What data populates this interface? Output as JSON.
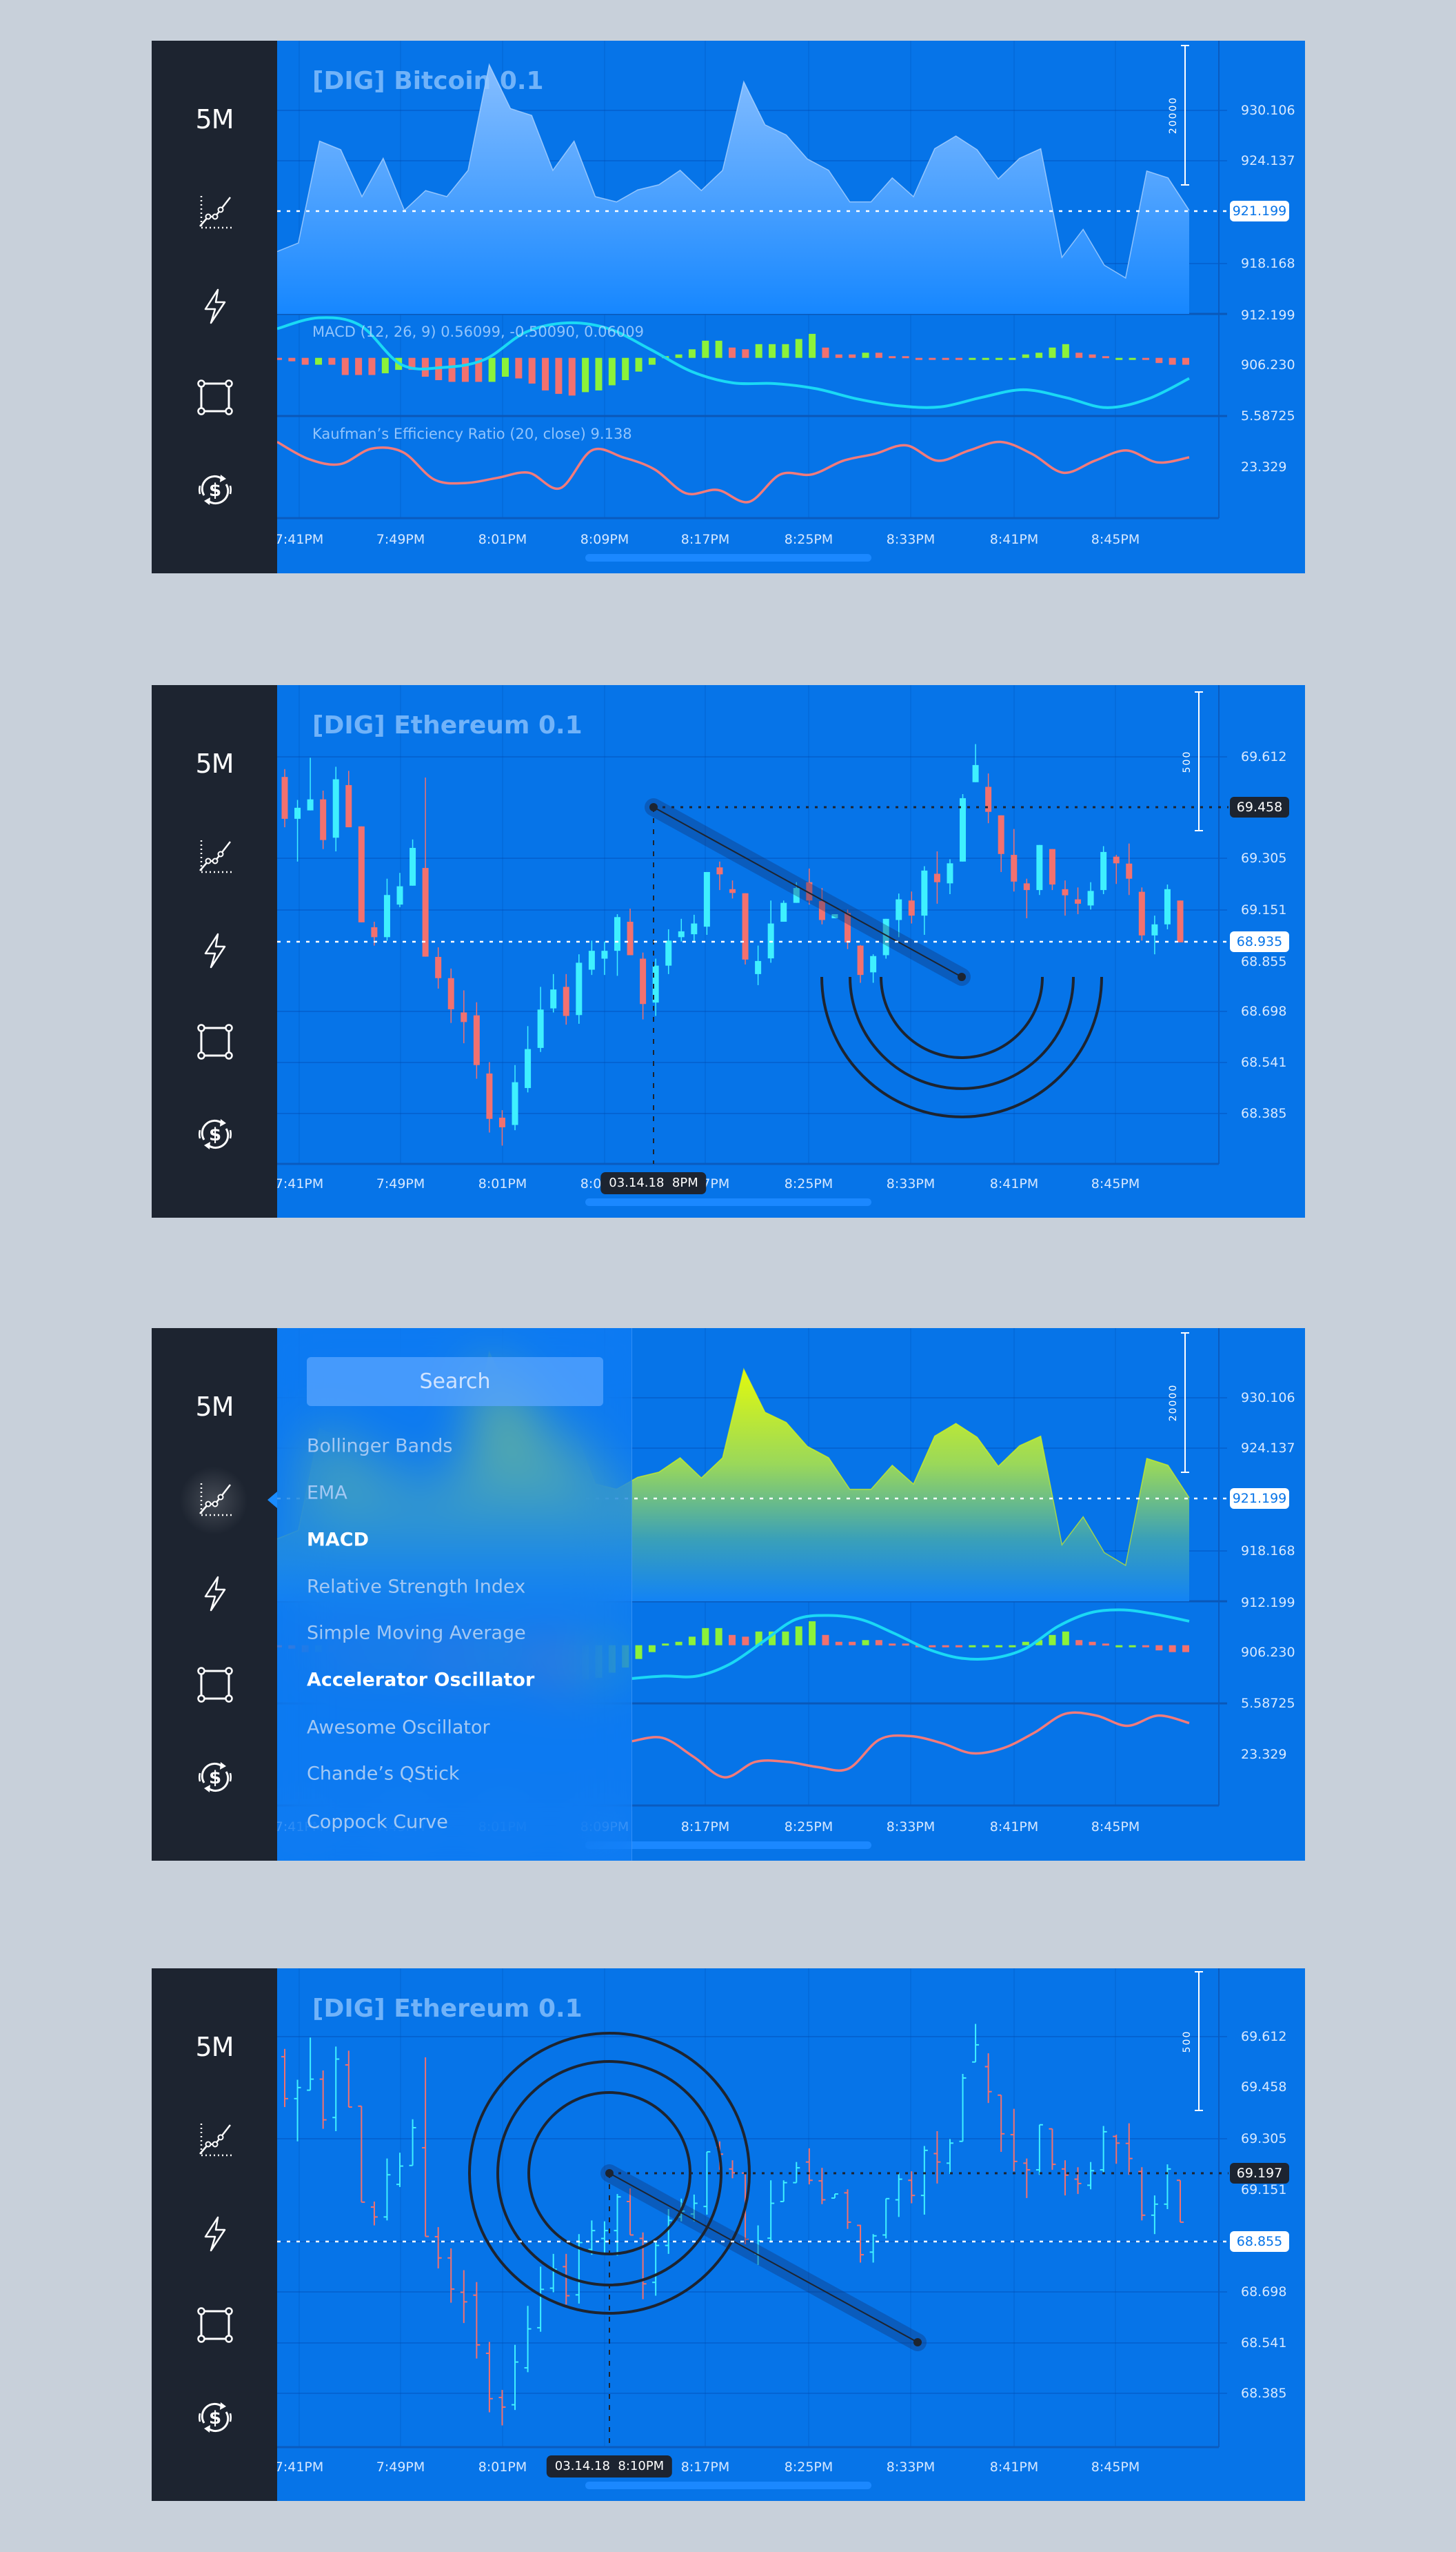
{
  "colors": {
    "page_background": "#c8d0da",
    "panel_blue": "#0674e8",
    "sidebar": "#1d2430",
    "candle_up": "#3ff0ff",
    "candle_down": "#f2716f",
    "histogram_up": "#8cf23a",
    "histogram_down": "#f2716f",
    "macd_line": "#1ad9f5",
    "ker_line": "#f27b7b",
    "area_top": "#86beff",
    "area_yellow": "#eeff00"
  },
  "sidebar": {
    "timeframe": "5M",
    "icons": [
      "indicators-chart-icon",
      "lightning-icon",
      "drawing-rectangle-icon",
      "currency-exchange-icon"
    ]
  },
  "time_axis": [
    "7:41PM",
    "7:49PM",
    "8:01PM",
    "8:09PM",
    "8:17PM",
    "8:25PM",
    "8:33PM",
    "8:41PM",
    "8:45PM"
  ],
  "panels": [
    {
      "title": "[DIG] Bitcoin 0.1",
      "price_labels": [
        "930.106",
        "924.137",
        "918.168",
        "912.199",
        "906.230",
        "5.58725",
        "23.329"
      ],
      "current_price": "921.199",
      "scale_label": "20000",
      "macd_label": "MACD (12, 26, 9) 0.56099, -0.50090, 0.06009",
      "ker_label": "Kaufman’s Efficiency Ratio (20, close) 9.138"
    },
    {
      "title": "[DIG] Ethereum 0.1",
      "price_labels": [
        "69.612",
        "69.305",
        "69.151",
        "68.855",
        "68.698",
        "68.541",
        "68.385"
      ],
      "current_price": "68.935",
      "crosshair_price": "69.458",
      "crosshair_time": "03.14.18  8PM",
      "scale_label": "500"
    },
    {
      "price_labels": [
        "930.106",
        "924.137",
        "918.168",
        "912.199",
        "906.230",
        "5.58725",
        "23.329"
      ],
      "current_price": "921.199",
      "scale_label": "20000",
      "menu": {
        "search_placeholder": "Search",
        "items": [
          {
            "label": "Bollinger Bands",
            "active": false
          },
          {
            "label": "EMA",
            "active": false
          },
          {
            "label": "MACD",
            "active": true
          },
          {
            "label": "Relative Strength Index",
            "active": false
          },
          {
            "label": "Simple Moving Average",
            "active": false
          },
          {
            "label": "Accelerator Oscillator",
            "active": true
          },
          {
            "label": "Awesome Oscillator",
            "active": false
          },
          {
            "label": "Chande’s QStick",
            "active": false
          },
          {
            "label": "Coppock Curve",
            "active": false
          }
        ]
      }
    },
    {
      "title": "[DIG] Ethereum 0.1",
      "price_labels": [
        "69.612",
        "69.458",
        "69.305",
        "69.151",
        "68.698",
        "68.541",
        "68.385"
      ],
      "current_price": "68.855",
      "crosshair_price": "69.197",
      "crosshair_time": "03.14.18  8:10PM",
      "scale_label": "500"
    }
  ],
  "chart_data": {
    "bitcoin_area": {
      "type": "area",
      "values": [
        917.77,
        918.52,
        927.42,
        926.67,
        922.57,
        925.92,
        921.37,
        923.1,
        922.57,
        924.87,
        934.1,
        930.27,
        929.67,
        924.87,
        927.42,
        922.57,
        922.11,
        923.16,
        923.61,
        924.87,
        923.1,
        924.87,
        932.61,
        928.85,
        927.96,
        925.86,
        924.87,
        922.11,
        922.11,
        924.21,
        922.57,
        926.76,
        927.87,
        926.67,
        924.12,
        925.92,
        926.76,
        917.26,
        919.71,
        916.57,
        915.46,
        924.81,
        924.21,
        921.37
      ]
    },
    "macd_histogram": {
      "type": "bar",
      "values": [
        -0.1,
        -0.2,
        -0.4,
        -0.4,
        -0.4,
        -1,
        -1,
        -1,
        -0.9,
        -0.7,
        -0.7,
        -1.1,
        -1.3,
        -1.4,
        -1.4,
        -1.4,
        -1.4,
        -1.1,
        -1.2,
        -1.5,
        -1.9,
        -2.1,
        -2.2,
        -2.0,
        -1.9,
        -1.6,
        -1.3,
        -0.8,
        -0.4,
        0.1,
        0.2,
        0.5,
        1.0,
        1.0,
        0.6,
        0.5,
        0.8,
        0.8,
        0.8,
        1.1,
        1.4,
        0.6,
        0.2,
        0.2,
        0.3,
        0.3,
        0.1,
        0.1,
        -0.05,
        -0.05,
        -0.1,
        -0.1,
        -0.05,
        -0.05,
        -0.05,
        -0.05,
        0.2,
        0.3,
        0.6,
        0.8,
        0.3,
        0.2,
        0.1,
        -0.05,
        -0.05,
        -0.1,
        -0.3,
        -0.4,
        -0.4
      ],
      "colors": [
        "r",
        "r",
        "r",
        "g",
        "r",
        "r",
        "r",
        "r",
        "g",
        "g",
        "r",
        "r",
        "r",
        "r",
        "r",
        "r",
        "g",
        "g",
        "r",
        "r",
        "r",
        "r",
        "r",
        "g",
        "g",
        "g",
        "g",
        "g",
        "g",
        "g",
        "g",
        "g",
        "g",
        "g",
        "r",
        "r",
        "g",
        "g",
        "g",
        "g",
        "g",
        "r",
        "r",
        "r",
        "g",
        "r",
        "r",
        "r",
        "r",
        "r",
        "r",
        "r",
        "g",
        "g",
        "g",
        "g",
        "g",
        "g",
        "g",
        "g",
        "r",
        "r",
        "r",
        "g",
        "g",
        "r",
        "r",
        "r",
        "r"
      ]
    },
    "macd_line_bitcoin": {
      "type": "line",
      "values": [
        1.7,
        2.34,
        1.9,
        -0.4,
        -0.56,
        -0.1,
        1.5,
        2.04,
        1.7,
        0.5,
        -0.8,
        -1.46,
        -1.5,
        -1.8,
        -2.4,
        -2.8,
        -2.86,
        -2.3,
        -1.86,
        -2.3,
        -2.9,
        -2.4,
        -1.2
      ]
    },
    "ker_line_bitcoin": {
      "type": "line",
      "values": [
        24.059,
        23.559,
        23.409,
        23.859,
        23.759,
        22.959,
        22.859,
        23.009,
        23.159,
        22.709,
        23.809,
        23.609,
        23.259,
        22.559,
        22.659,
        22.309,
        23.109,
        23.109,
        23.509,
        23.709,
        23.959,
        23.509,
        23.809,
        24.059,
        23.709,
        23.159,
        23.509,
        23.809,
        23.459,
        23.609
      ]
    },
    "macd_line_menu_view": {
      "type": "line",
      "values": [
        -1.94,
        -1.8,
        -1.8,
        -1.1,
        0.2,
        1.5,
        1.74,
        1.5,
        0.7,
        -0.2,
        -0.74,
        -0.76,
        -0.2,
        1.1,
        1.9,
        2.06,
        1.8,
        1.4
      ]
    },
    "ker_line_menu_view": {
      "type": "line",
      "values": [
        23.709,
        23.809,
        23.259,
        22.659,
        23.109,
        23.109,
        22.959,
        22.909,
        23.759,
        23.859,
        23.659,
        23.359,
        23.509,
        23.959,
        24.509,
        24.459,
        24.159,
        24.459,
        24.239
      ]
    },
    "ethereum_candles": {
      "type": "candlestick",
      "fields": [
        "open",
        "high",
        "low",
        "close"
      ],
      "values": [
        [
          69.543,
          69.57,
          69.37,
          69.399
        ],
        [
          69.399,
          69.464,
          69.252,
          69.437
        ],
        [
          69.428,
          69.609,
          69.428,
          69.466
        ],
        [
          69.466,
          69.496,
          69.295,
          69.326
        ],
        [
          69.334,
          69.578,
          69.287,
          69.535
        ],
        [
          69.515,
          69.564,
          69.37,
          69.37
        ],
        [
          69.373,
          69.373,
          69.043,
          69.043
        ],
        [
          69.026,
          69.045,
          68.963,
          68.992
        ],
        [
          68.992,
          69.193,
          68.98,
          69.137
        ],
        [
          69.104,
          69.213,
          69.095,
          69.167
        ],
        [
          69.169,
          69.328,
          69.169,
          69.299
        ],
        [
          69.23,
          69.541,
          68.925,
          68.925
        ],
        [
          68.924,
          68.957,
          68.815,
          68.851
        ],
        [
          68.851,
          68.884,
          68.697,
          68.744
        ],
        [
          68.733,
          68.809,
          68.627,
          68.7
        ],
        [
          68.723,
          68.768,
          68.505,
          68.552
        ],
        [
          68.523,
          68.562,
          68.32,
          68.367
        ],
        [
          68.371,
          68.397,
          68.275,
          68.338
        ],
        [
          68.346,
          68.552,
          68.328,
          68.493
        ],
        [
          68.473,
          68.686,
          68.458,
          68.607
        ],
        [
          68.611,
          68.821,
          68.597,
          68.743
        ],
        [
          68.747,
          68.865,
          68.733,
          68.812
        ],
        [
          68.821,
          68.865,
          68.691,
          68.721
        ],
        [
          68.724,
          68.933,
          68.694,
          68.904
        ],
        [
          68.88,
          68.98,
          68.862,
          68.945
        ],
        [
          68.918,
          68.977,
          68.862,
          68.945
        ],
        [
          68.945,
          69.071,
          68.859,
          69.061
        ],
        [
          69.045,
          69.09,
          68.93,
          68.93
        ],
        [
          68.918,
          68.939,
          68.709,
          68.762
        ],
        [
          68.767,
          68.918,
          68.721,
          68.894
        ],
        [
          68.894,
          69.019,
          68.865,
          68.98
        ],
        [
          68.992,
          69.055,
          68.977,
          69.012
        ],
        [
          69.002,
          69.069,
          68.977,
          69.039
        ],
        [
          69.028,
          69.216,
          69.0,
          69.216
        ],
        [
          69.232,
          69.252,
          69.154,
          69.208
        ],
        [
          69.157,
          69.187,
          69.125,
          69.144
        ],
        [
          69.143,
          69.143,
          68.898,
          68.915
        ],
        [
          68.865,
          68.963,
          68.827,
          68.91
        ],
        [
          68.919,
          69.118,
          68.904,
          69.039
        ],
        [
          69.045,
          69.118,
          69.045,
          69.11
        ],
        [
          69.11,
          69.181,
          69.11,
          69.161
        ],
        [
          69.181,
          69.228,
          69.104,
          69.118
        ],
        [
          69.116,
          69.161,
          69.036,
          69.051
        ],
        [
          69.057,
          69.071,
          69.057,
          69.071
        ],
        [
          69.075,
          69.087,
          68.951,
          68.974
        ],
        [
          68.963,
          68.965,
          68.835,
          68.862
        ],
        [
          68.871,
          68.933,
          68.835,
          68.927
        ],
        [
          68.93,
          69.055,
          68.918,
          69.055
        ],
        [
          69.051,
          69.142,
          68.992,
          69.122
        ],
        [
          69.118,
          69.149,
          69.039,
          69.066
        ],
        [
          69.066,
          69.236,
          69.0,
          69.221
        ],
        [
          69.21,
          69.287,
          69.107,
          69.181
        ],
        [
          69.177,
          69.26,
          69.14,
          69.246
        ],
        [
          69.252,
          69.484,
          69.252,
          69.47
        ],
        [
          69.525,
          69.656,
          69.525,
          69.584
        ],
        [
          69.509,
          69.555,
          69.384,
          69.423
        ],
        [
          69.411,
          69.411,
          69.216,
          69.278
        ],
        [
          69.275,
          69.364,
          69.149,
          69.183
        ],
        [
          69.177,
          69.193,
          69.057,
          69.154
        ],
        [
          69.154,
          69.309,
          69.137,
          69.309
        ],
        [
          69.295,
          69.295,
          69.154,
          69.173
        ],
        [
          69.157,
          69.187,
          69.066,
          69.136
        ],
        [
          69.122,
          69.163,
          69.071,
          69.107
        ],
        [
          69.101,
          69.181,
          69.087,
          69.151
        ],
        [
          69.154,
          69.305,
          69.14,
          69.285
        ],
        [
          69.269,
          69.275,
          69.175,
          69.246
        ],
        [
          69.245,
          69.314,
          69.137,
          69.193
        ],
        [
          69.148,
          69.163,
          68.98,
          68.998
        ],
        [
          68.998,
          69.066,
          68.933,
          69.036
        ],
        [
          69.036,
          69.173,
          69.019,
          69.157
        ],
        [
          69.118,
          69.118,
          68.974,
          68.974
        ]
      ]
    }
  }
}
